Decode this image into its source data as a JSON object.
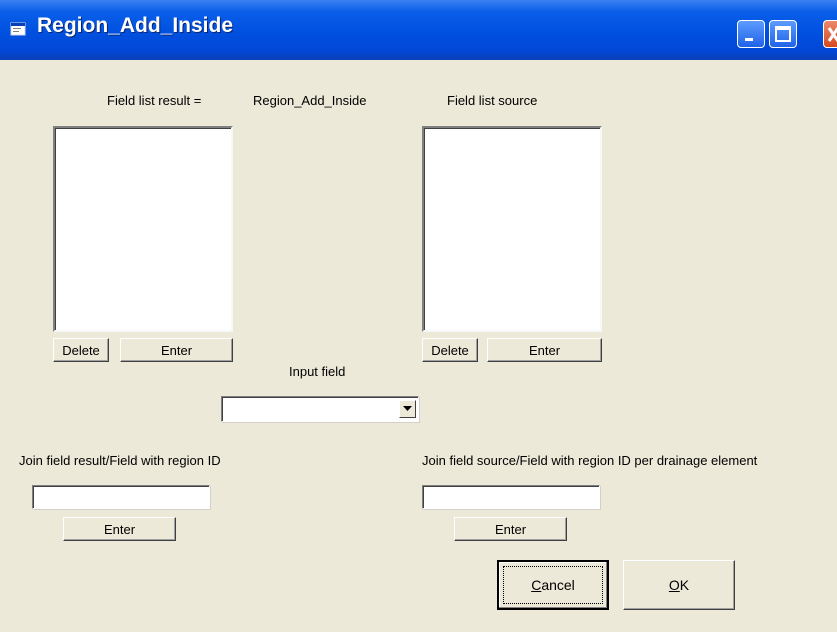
{
  "window": {
    "title": "Region_Add_Inside"
  },
  "labels": {
    "field_list_result": "Field list result =",
    "region_name": "Region_Add_Inside",
    "field_list_source": "Field list source",
    "input_field": "Input field",
    "join_result": "Join field result/Field with region ID",
    "join_source": "Join field source/Field with region ID per drainage element"
  },
  "buttons": {
    "delete": "Delete",
    "enter": "Enter",
    "cancel_accel": "C",
    "cancel_rest": "ancel",
    "ok_accel": "O",
    "ok_rest": "K"
  },
  "inputs": {
    "input_field_value": "",
    "join_result_value": "",
    "join_source_value": ""
  },
  "colors": {
    "title_bar": "#0050e0",
    "face": "#ece9d8",
    "close": "#d6491e"
  },
  "icons": {
    "app": "app-icon",
    "minimize": "minimize-icon",
    "maximize": "maximize-icon",
    "close": "close-icon",
    "dropdown": "chevron-down-icon"
  }
}
